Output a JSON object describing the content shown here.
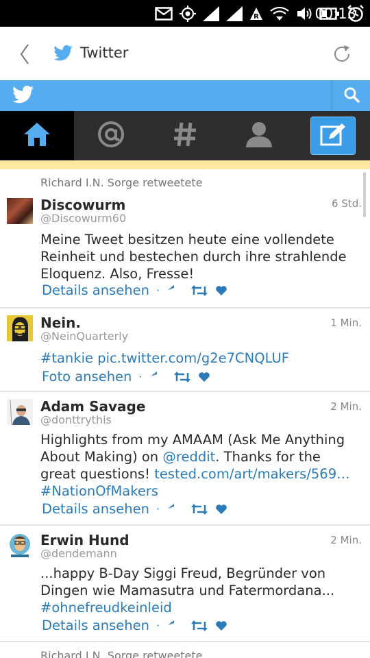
{
  "status_bar": {
    "time": "00:13"
  },
  "app_bar": {
    "title": "Twitter"
  },
  "tabs": [
    {
      "name": "home",
      "active": true
    },
    {
      "name": "mentions",
      "active": false
    },
    {
      "name": "discover",
      "active": false
    },
    {
      "name": "me",
      "active": false
    },
    {
      "name": "compose",
      "active": false
    }
  ],
  "colors": {
    "brand": "#55acee",
    "link": "#2b7bb9",
    "highlight": "#fde7a1"
  },
  "tweets": [
    {
      "retweeted_by": "Richard I.N. Sorge retweetete",
      "name": "Discowurm",
      "handle": "@Discowurm60",
      "time": "6 Std.",
      "text": "Meine Tweet besitzen heute eine vollendete Reinheit und bestechen durch ihre strahlende Eloquenz. Also, Fresse!",
      "action_label": "Details ansehen"
    },
    {
      "name": "Nein.",
      "handle": "@NeinQuarterly",
      "time": "1 Min.",
      "text_link": "#tankie pic.twitter.com/g2e7CNQLUF",
      "action_label": "Foto ansehen"
    },
    {
      "name": "Adam Savage",
      "handle": "@donttrythis",
      "time": "2 Min.",
      "text_part1": "Highlights from my AMAAM (Ask Me Anything About Making) on ",
      "text_mention": "@reddit",
      "text_part2": ". Thanks for the great questions! ",
      "text_url": "tested.com/art/makers/569…",
      "text_hashtag": "#NationOfMakers",
      "action_label": "Details ansehen"
    },
    {
      "name": "Erwin Hund",
      "handle": "@dendemann",
      "time": "2 Min.",
      "text": "...happy B-Day Siggi Freud, Begründer von Dingen wie Mamasutra und Fatermordana...",
      "text_hashtag": "#ohnefreudkeinleid",
      "action_label": "Details ansehen"
    },
    {
      "retweeted_by": "Richard I.N. Sorge retweetete"
    }
  ]
}
